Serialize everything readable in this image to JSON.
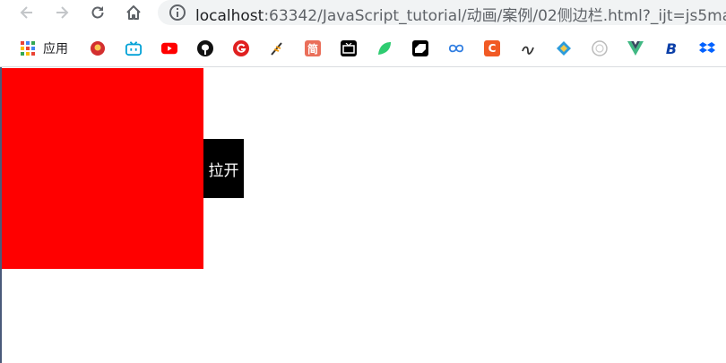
{
  "browser": {
    "url_host": "localhost",
    "url_rest": ":63342/JavaScript_tutorial/动画/案例/02侧边栏.html?_ijt=js5ma"
  },
  "bookmarks": {
    "apps_label": "应用",
    "items": [
      {
        "icon": "emblem-icon",
        "color": "#d32f2f"
      },
      {
        "icon": "bilibili-icon",
        "color": "#00a1d6"
      },
      {
        "icon": "youtube-icon",
        "color": "#ff0000"
      },
      {
        "icon": "github-icon",
        "color": "#111111"
      },
      {
        "icon": "g-red-icon",
        "color": "#e02020"
      },
      {
        "icon": "feather-icon",
        "color": "#333333"
      },
      {
        "icon": "jianshu-icon",
        "glyph": "简",
        "color": "#ea6f5a"
      },
      {
        "icon": "tv-icon",
        "color": "#000000"
      },
      {
        "icon": "leaf-icon",
        "color": "#2ecc71"
      },
      {
        "icon": "csdn-icon",
        "color": "#000000"
      },
      {
        "icon": "infinity-icon",
        "color": "#2f7de1"
      },
      {
        "icon": "c-icon",
        "glyph": "C",
        "color": "#f15a24"
      },
      {
        "icon": "script-icon",
        "color": "#333333"
      },
      {
        "icon": "diamond-icon",
        "color": "#2d9cdb"
      },
      {
        "icon": "badge-icon",
        "color": "#bbbbbb"
      },
      {
        "icon": "vue-icon",
        "color": "#41b883"
      },
      {
        "icon": "b-icon",
        "glyph": "B",
        "color": "#0b3fa8"
      },
      {
        "icon": "dropbox-icon",
        "color": "#0061ff"
      }
    ]
  },
  "page": {
    "toggle_label": "拉开",
    "sidebar_color": "#ff0000",
    "toggle_color": "#000000"
  }
}
